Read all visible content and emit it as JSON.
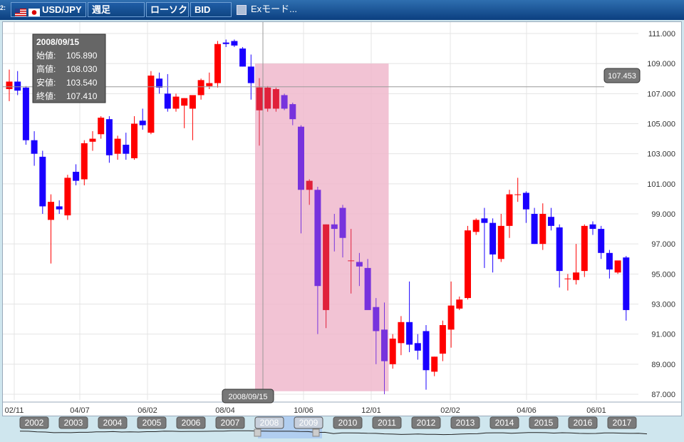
{
  "toolbar": {
    "pane_number": "2:",
    "symbol": "USD/JPY",
    "period": "週足",
    "chart_style": "ローソク",
    "price_side": "BID",
    "ex_mode": "Exモード..."
  },
  "colors": {
    "up": "#ff0000",
    "down": "#1a00ff",
    "highlight_up": "#e0203a",
    "highlight_down": "#7733dd",
    "selection": "#f0b8cc"
  },
  "tooltip": {
    "date": "2008/09/15",
    "rows": [
      {
        "label": "始値:",
        "value": "105.890"
      },
      {
        "label": "高値:",
        "value": "108.030"
      },
      {
        "label": "安値:",
        "value": "103.540"
      },
      {
        "label": "終値:",
        "value": "107.410"
      }
    ]
  },
  "chart_data": {
    "type": "candlestick",
    "ylim": [
      86.5,
      112
    ],
    "y_ticks": [
      "111.000",
      "109.000",
      "107.000",
      "105.000",
      "103.000",
      "101.000",
      "99.000",
      "97.000",
      "95.000",
      "93.000",
      "91.000",
      "89.000",
      "87.000"
    ],
    "x_ticks": [
      "02/11",
      "04/07",
      "06/02",
      "08/04",
      "10/06",
      "12/01",
      "02/02",
      "04/06",
      "06/01"
    ],
    "crosshair_price": "107.453",
    "crosshair_date": "2008/09/15",
    "selection_range": [
      109.0,
      87.2
    ],
    "candles": [
      {
        "o": 107.3,
        "h": 108.6,
        "l": 106.5,
        "c": 107.8
      },
      {
        "o": 107.8,
        "h": 108.5,
        "l": 106.9,
        "c": 107.2
      },
      {
        "o": 107.4,
        "h": 107.5,
        "l": 103.6,
        "c": 103.9
      },
      {
        "o": 103.9,
        "h": 104.5,
        "l": 102.2,
        "c": 103.0
      },
      {
        "o": 102.8,
        "h": 103.2,
        "l": 99.0,
        "c": 99.5
      },
      {
        "o": 98.6,
        "h": 100.3,
        "l": 95.7,
        "c": 99.8
      },
      {
        "o": 99.5,
        "h": 99.9,
        "l": 99.0,
        "c": 99.3
      },
      {
        "o": 98.9,
        "h": 101.6,
        "l": 98.6,
        "c": 101.4
      },
      {
        "o": 101.8,
        "h": 102.3,
        "l": 100.9,
        "c": 101.2
      },
      {
        "o": 101.3,
        "h": 103.9,
        "l": 100.9,
        "c": 103.7
      },
      {
        "o": 103.8,
        "h": 104.5,
        "l": 103.2,
        "c": 104.0
      },
      {
        "o": 104.3,
        "h": 105.5,
        "l": 104.0,
        "c": 105.4
      },
      {
        "o": 105.3,
        "h": 105.5,
        "l": 102.4,
        "c": 102.9
      },
      {
        "o": 103.0,
        "h": 104.2,
        "l": 102.6,
        "c": 104.0
      },
      {
        "o": 103.6,
        "h": 104.4,
        "l": 102.6,
        "c": 103.0
      },
      {
        "o": 102.7,
        "h": 105.5,
        "l": 102.6,
        "c": 105.0
      },
      {
        "o": 105.2,
        "h": 106.0,
        "l": 104.6,
        "c": 104.9
      },
      {
        "o": 104.4,
        "h": 108.5,
        "l": 104.3,
        "c": 108.2
      },
      {
        "o": 108.0,
        "h": 108.4,
        "l": 107.0,
        "c": 107.4
      },
      {
        "o": 107.0,
        "h": 108.3,
        "l": 105.8,
        "c": 106.0
      },
      {
        "o": 106.0,
        "h": 107.0,
        "l": 105.8,
        "c": 106.8
      },
      {
        "o": 106.2,
        "h": 106.7,
        "l": 104.7,
        "c": 106.7
      },
      {
        "o": 106.0,
        "h": 106.8,
        "l": 103.9,
        "c": 106.9
      },
      {
        "o": 106.9,
        "h": 108.0,
        "l": 106.6,
        "c": 107.9
      },
      {
        "o": 107.5,
        "h": 108.4,
        "l": 107.3,
        "c": 107.7
      },
      {
        "o": 107.7,
        "h": 110.5,
        "l": 107.4,
        "c": 110.3
      },
      {
        "o": 110.4,
        "h": 110.6,
        "l": 110.1,
        "c": 110.3
      },
      {
        "o": 110.5,
        "h": 110.6,
        "l": 110.1,
        "c": 110.2
      },
      {
        "o": 110.0,
        "h": 110.1,
        "l": 108.8,
        "c": 108.8
      },
      {
        "o": 108.8,
        "h": 109.6,
        "l": 106.6,
        "c": 107.7
      },
      {
        "o": 105.89,
        "h": 108.03,
        "l": 103.54,
        "c": 107.41
      },
      {
        "o": 106.0,
        "h": 107.5,
        "l": 105.8,
        "c": 107.4
      },
      {
        "o": 106.0,
        "h": 107.4,
        "l": 105.8,
        "c": 107.3
      },
      {
        "o": 106.9,
        "h": 107.0,
        "l": 105.9,
        "c": 106.0
      },
      {
        "o": 106.3,
        "h": 106.4,
        "l": 104.9,
        "c": 105.3
      },
      {
        "o": 104.8,
        "h": 104.9,
        "l": 97.7,
        "c": 100.6
      },
      {
        "o": 100.6,
        "h": 101.3,
        "l": 99.6,
        "c": 101.2
      },
      {
        "o": 100.6,
        "h": 100.8,
        "l": 91.0,
        "c": 94.2
      },
      {
        "o": 92.6,
        "h": 98.3,
        "l": 91.4,
        "c": 98.3
      },
      {
        "o": 98.3,
        "h": 99.0,
        "l": 96.5,
        "c": 98.0
      },
      {
        "o": 99.4,
        "h": 99.6,
        "l": 96.1,
        "c": 97.4
      },
      {
        "o": 95.9,
        "h": 98.0,
        "l": 93.7,
        "c": 95.9
      },
      {
        "o": 95.8,
        "h": 96.4,
        "l": 94.2,
        "c": 95.5
      },
      {
        "o": 95.4,
        "h": 96.0,
        "l": 93.0,
        "c": 92.6
      },
      {
        "o": 92.8,
        "h": 93.4,
        "l": 89.0,
        "c": 91.2
      },
      {
        "o": 91.3,
        "h": 93.1,
        "l": 87.0,
        "c": 89.2
      },
      {
        "o": 89.0,
        "h": 91.0,
        "l": 88.7,
        "c": 90.7
      },
      {
        "o": 90.4,
        "h": 92.2,
        "l": 89.6,
        "c": 91.8
      },
      {
        "o": 91.8,
        "h": 94.5,
        "l": 89.8,
        "c": 90.3
      },
      {
        "o": 90.4,
        "h": 91.0,
        "l": 89.3,
        "c": 89.9
      },
      {
        "o": 91.2,
        "h": 91.6,
        "l": 87.3,
        "c": 88.6
      },
      {
        "o": 88.5,
        "h": 89.5,
        "l": 88.2,
        "c": 89.5
      },
      {
        "o": 89.7,
        "h": 91.9,
        "l": 89.2,
        "c": 91.6
      },
      {
        "o": 91.3,
        "h": 94.5,
        "l": 90.1,
        "c": 92.9
      },
      {
        "o": 92.7,
        "h": 93.5,
        "l": 92.6,
        "c": 93.3
      },
      {
        "o": 93.4,
        "h": 98.2,
        "l": 93.3,
        "c": 97.9
      },
      {
        "o": 97.8,
        "h": 98.7,
        "l": 97.6,
        "c": 98.6
      },
      {
        "o": 98.7,
        "h": 99.4,
        "l": 95.4,
        "c": 98.4
      },
      {
        "o": 98.4,
        "h": 98.7,
        "l": 95.1,
        "c": 96.3
      },
      {
        "o": 96.0,
        "h": 99.0,
        "l": 95.8,
        "c": 98.2
      },
      {
        "o": 98.2,
        "h": 100.6,
        "l": 97.4,
        "c": 100.3
      },
      {
        "o": 100.3,
        "h": 101.4,
        "l": 99.8,
        "c": 100.3
      },
      {
        "o": 100.4,
        "h": 100.5,
        "l": 98.4,
        "c": 99.3
      },
      {
        "o": 99.0,
        "h": 99.4,
        "l": 97.0,
        "c": 97.0
      },
      {
        "o": 97.0,
        "h": 99.7,
        "l": 96.6,
        "c": 99.0
      },
      {
        "o": 98.8,
        "h": 99.4,
        "l": 97.9,
        "c": 98.2
      },
      {
        "o": 98.1,
        "h": 98.3,
        "l": 94.1,
        "c": 95.2
      },
      {
        "o": 94.7,
        "h": 95.0,
        "l": 93.9,
        "c": 94.7
      },
      {
        "o": 94.6,
        "h": 97.0,
        "l": 94.3,
        "c": 95.1
      },
      {
        "o": 95.2,
        "h": 98.3,
        "l": 94.8,
        "c": 98.2
      },
      {
        "o": 98.3,
        "h": 98.5,
        "l": 97.6,
        "c": 98.0
      },
      {
        "o": 98.0,
        "h": 98.2,
        "l": 96.0,
        "c": 96.4
      },
      {
        "o": 96.4,
        "h": 96.6,
        "l": 94.7,
        "c": 95.3
      },
      {
        "o": 95.1,
        "h": 95.8,
        "l": 95.0,
        "c": 95.9
      },
      {
        "o": 96.1,
        "h": 96.2,
        "l": 91.9,
        "c": 92.6
      }
    ],
    "highlight_start": 30,
    "highlight_end": 45
  },
  "navigator": {
    "years": [
      "2002",
      "2003",
      "2004",
      "2005",
      "2006",
      "2007",
      "2008",
      "2009",
      "2010",
      "2011",
      "2012",
      "2013",
      "2014",
      "2015",
      "2016",
      "2017"
    ],
    "active_years": [
      "2008",
      "2009"
    ]
  }
}
